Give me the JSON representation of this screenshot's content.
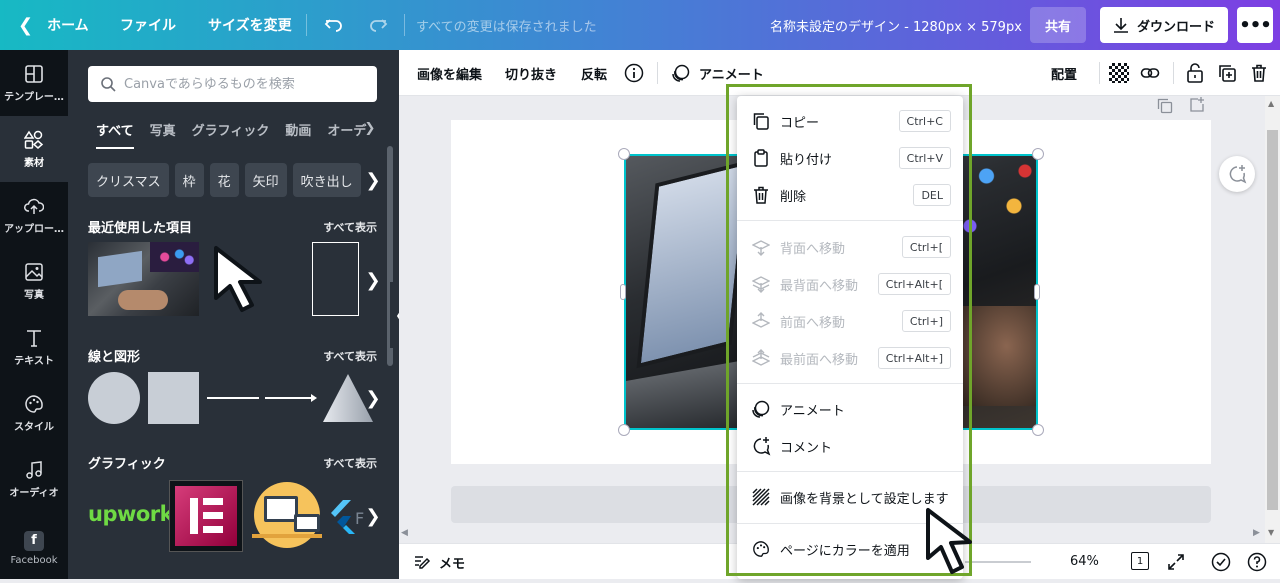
{
  "topbar": {
    "home": "ホーム",
    "file": "ファイル",
    "resize": "サイズを変更",
    "saved_status": "すべての変更は保存されました",
    "doc_title": "名称未設定のデザイン - 1280px × 579px",
    "share": "共有",
    "download": "ダウンロード",
    "more": "•••"
  },
  "rail": {
    "items": [
      {
        "label": "テンプレー…",
        "icon": "template-icon"
      },
      {
        "label": "素材",
        "icon": "elements-icon"
      },
      {
        "label": "アップロー…",
        "icon": "upload-icon"
      },
      {
        "label": "写真",
        "icon": "photo-icon"
      },
      {
        "label": "テキスト",
        "icon": "text-icon"
      },
      {
        "label": "スタイル",
        "icon": "palette-icon"
      },
      {
        "label": "オーディオ",
        "icon": "music-icon"
      },
      {
        "label": "Facebook",
        "icon": "facebook-icon"
      }
    ]
  },
  "panel": {
    "search_placeholder": "Canvaであらゆるものを検索",
    "tabs": [
      "すべて",
      "写真",
      "グラフィック",
      "動画",
      "オーデ"
    ],
    "chips": [
      "クリスマス",
      "枠",
      "花",
      "矢印",
      "吹き出し"
    ],
    "recent_title": "最近使用した項目",
    "lines_title": "線と図形",
    "graphics_title": "グラフィック",
    "see_all": "すべて表示",
    "upwork_logo": "upwork"
  },
  "toolbar": {
    "edit_image": "画像を編集",
    "crop": "切り抜き",
    "flip": "反転",
    "animate": "アニメート",
    "position": "配置"
  },
  "bottombar": {
    "notes": "メモ",
    "zoom": "64%",
    "page_count": "1"
  },
  "menu": {
    "items": [
      {
        "label": "コピー",
        "shortcut": "Ctrl+C",
        "disabled": false
      },
      {
        "label": "貼り付け",
        "shortcut": "Ctrl+V",
        "disabled": false
      },
      {
        "label": "削除",
        "shortcut": "DEL",
        "disabled": false
      },
      {
        "label": "背面へ移動",
        "shortcut": "Ctrl+[",
        "disabled": true
      },
      {
        "label": "最背面へ移動",
        "shortcut": "Ctrl+Alt+[",
        "disabled": true
      },
      {
        "label": "前面へ移動",
        "shortcut": "Ctrl+]",
        "disabled": true
      },
      {
        "label": "最前面へ移動",
        "shortcut": "Ctrl+Alt+]",
        "disabled": true
      },
      {
        "label": "アニメート",
        "shortcut": "",
        "disabled": false
      },
      {
        "label": "コメント",
        "shortcut": "",
        "disabled": false
      },
      {
        "label": "画像を背景として設定します",
        "shortcut": "",
        "disabled": false
      },
      {
        "label": "ページにカラーを適用",
        "shortcut": "",
        "disabled": false
      }
    ]
  },
  "colors": {
    "highlight": "#6fa52a",
    "selection": "#00c4cc"
  }
}
